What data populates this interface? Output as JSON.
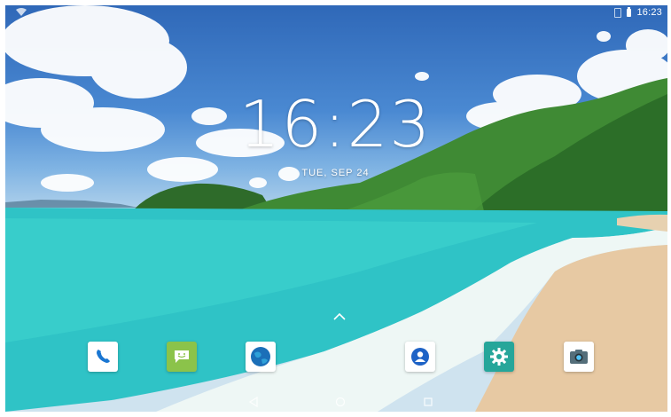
{
  "status_bar": {
    "time": "16:23"
  },
  "lockscreen": {
    "clock": "16:23",
    "date": "TUE, SEP 24"
  },
  "dock": {
    "apps": [
      {
        "icon": "phone-icon",
        "color": "#ffffff"
      },
      {
        "icon": "messaging-icon",
        "color": "#8bc34a"
      },
      {
        "icon": "browser-icon",
        "color": "#ffffff"
      },
      {
        "icon": "contacts-icon",
        "color": "#ffffff"
      },
      {
        "icon": "settings-icon",
        "color": "#26a69a"
      },
      {
        "icon": "camera-icon",
        "color": "#ffffff"
      }
    ]
  },
  "nav_bar": {
    "icons": [
      "back-icon",
      "home-icon",
      "recents-icon"
    ]
  }
}
